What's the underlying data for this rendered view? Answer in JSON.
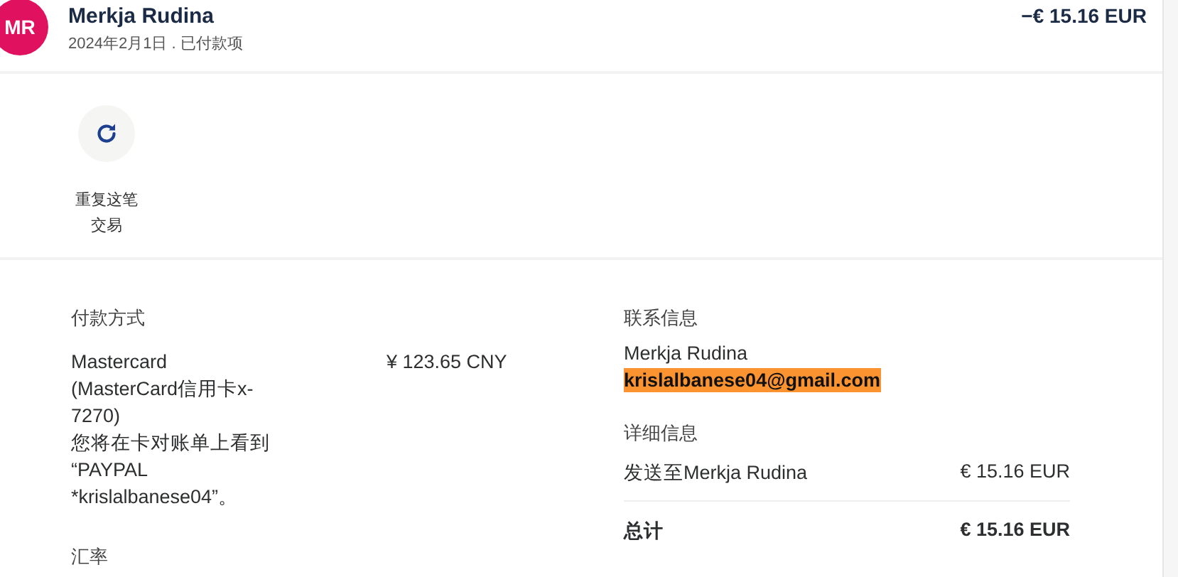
{
  "header": {
    "avatar": "MR",
    "name": "Merkja Rudina",
    "subtitle": "2024年2月1日 . 已付款项",
    "amount": "−€ 15.16 EUR"
  },
  "actions": [
    {
      "label_lines": [
        "重复这笔",
        "交易"
      ]
    }
  ],
  "payment": {
    "heading": "付款方式",
    "lines": [
      "Mastercard",
      "(MasterCard信用卡x-",
      "7270)",
      "您将在卡对账单上看到",
      "“PAYPAL",
      "*krislalbanese04”。"
    ],
    "amount": "¥ 123.65 CNY",
    "rate_heading": "汇率"
  },
  "contact": {
    "heading": "联系信息",
    "name": "Merkja Rudina",
    "email": "krislalbanese04@gmail.com",
    "email_highlighted": true
  },
  "details": {
    "heading": "详细信息",
    "rows": [
      {
        "label": "发送至Merkja Rudina",
        "value": "€ 15.16 EUR",
        "kind": "item"
      },
      {
        "label": "总计",
        "value": "€ 15.16 EUR",
        "kind": "total"
      }
    ]
  }
}
